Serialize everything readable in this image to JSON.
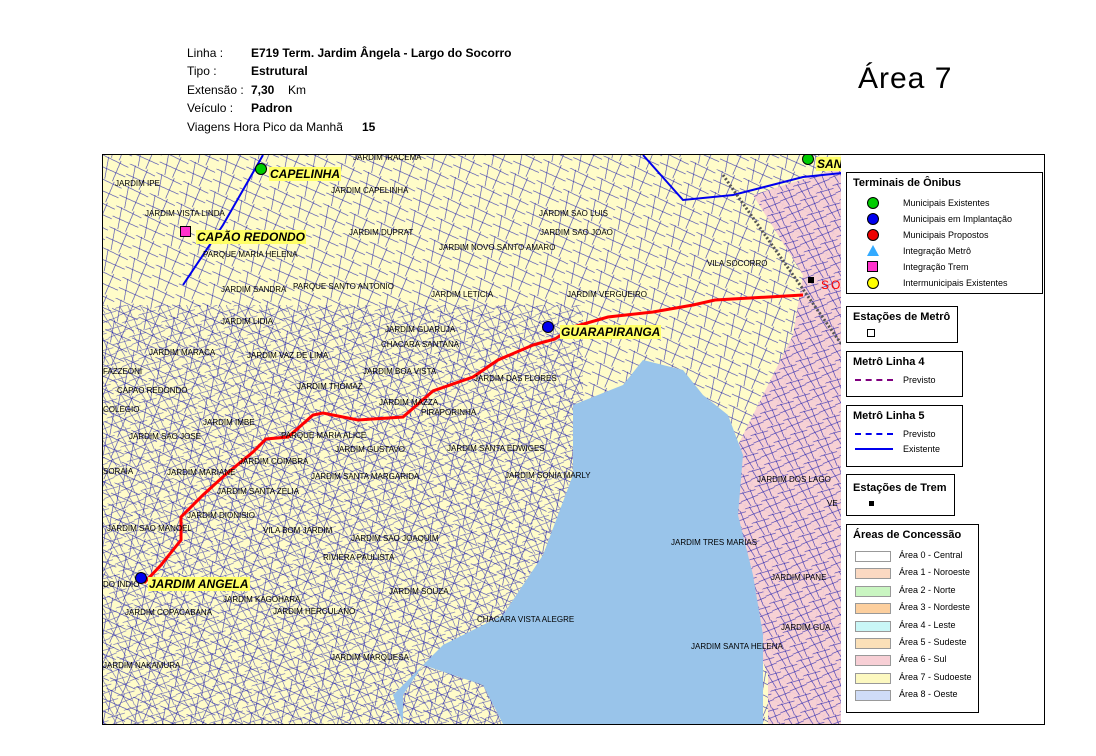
{
  "header": {
    "linha_label": "Linha :",
    "linha_value": "E719     Term. Jardim Ângela  - Largo do Socorro",
    "tipo_label": "Tipo :",
    "tipo_value": "Estrutural",
    "extensao_label": "Extensão :",
    "extensao_value": "7,30",
    "extensao_unit": "Km",
    "veiculo_label": "Veículo :",
    "veiculo_value": "Padron",
    "viagens_label": "Viagens Hora Pico da Manhã",
    "viagens_value": "15"
  },
  "area_title": "Área  7",
  "colors": {
    "route": "#ff0000",
    "water": "#99c4ea",
    "area6": "#f7cfd5",
    "area7": "#fffcc9",
    "streets": "#1111aa",
    "metro_line5": "#0000ee"
  },
  "terminals": [
    {
      "name": "CAPELINHA",
      "type": "municipal-existente",
      "color": "#00cc00"
    },
    {
      "name": "CAPÃO REDONDO",
      "type": "integracao-trem",
      "color": "#ff33cc"
    },
    {
      "name": "GUARAPIRANGA",
      "type": "municipal-implantacao",
      "color": "#0000ee"
    },
    {
      "name": "JARDIM ANGELA",
      "type": "municipal-implantacao",
      "color": "#0000ee"
    },
    {
      "name": "SAN",
      "type": "municipal-existente",
      "color": "#00cc00"
    },
    {
      "name": "SO",
      "type": "estacao-trem",
      "color": "#ff0000"
    }
  ],
  "neighborhoods": [
    "JARDIM IRACEMA",
    "JARDIM IPE",
    "JARDIM CAPELINHA",
    "JARDIM VISTA LINDA",
    "JARDIM SAO LUIS",
    "JARDIM DUPRAT",
    "JARDIM SAO JOAO",
    "JARDIM NOVO SANTO AMARO",
    "PARQUE MARIA HELENA",
    "VILA SOCORRO",
    "PARQUE SANTO ANTONIO",
    "JARDIM SANDRA",
    "JARDIM LETICIA",
    "JARDIM VERGUEIRO",
    "JARDIM LIDIA",
    "JARDIM GUARUJA",
    "CHACARA SANTANA",
    "JARDIM MARACA",
    "JARDIM VAZ DE LIMA",
    "FAZZEONI",
    "JARDIM BOA VISTA",
    "CAPAO REDONDO",
    "JARDIM THOMAZ",
    "JARDIM DAS FLORES",
    "JARDIM MAZZA",
    "COLEGIO",
    "PIRAPORINHA",
    "JARDIM IMBE",
    "PARQUE MARIA ALICE",
    "JARDIM SAO JOSE",
    "JARDIM GUSTAVO",
    "JARDIM SANTA EDWIGES",
    "JARDIM COIMBRA",
    "SORAIA",
    "JARDIM MARIANE",
    "JARDIM SANTA MARGARIDA",
    "JARDIM SONIA MARLY",
    "JARDIM DOS LAGO",
    "JARDIM SANTA ZELIA",
    "JARDIM DIONISIO",
    "JARDIM SAO MANOEL",
    "VILA BOM JARDIM",
    "JARDIM SAO JOAQUIM",
    "JARDIM TRES MARIAS",
    "RIVIERA PAULISTA",
    "JARDIM IPANE",
    "DO INDIO",
    "JARDIM KAGOHARA",
    "JARDIM SOUZA",
    "JARDIM COPACABANA",
    "JARDIM HERCULANO",
    "CHACARA VISTA ALEGRE",
    "JARDIM GUA",
    "JARDIM SANTA HELENA",
    "JARDIM MARQUESA",
    "JARDIM NAKAMURA",
    "VE"
  ],
  "legend": {
    "terminais_title": "Terminais de Ônibus",
    "terminais_items": [
      {
        "label": "Municipais Existentes",
        "color": "#00cc00",
        "shape": "circle"
      },
      {
        "label": "Municipais em Implantação",
        "color": "#0000ee",
        "shape": "circle"
      },
      {
        "label": "Municipais Propostos",
        "color": "#ee0000",
        "shape": "circle"
      },
      {
        "label": "Integração Metrô",
        "color": "#33aaff",
        "shape": "triangle"
      },
      {
        "label": "Integração Trem",
        "color": "#ff33cc",
        "shape": "square"
      },
      {
        "label": "Intermunicipais Existentes",
        "color": "#ffff00",
        "shape": "circle"
      }
    ],
    "estacoes_metro_title": "Estações de Metrô",
    "metro4_title": "Metrô Linha 4",
    "metro4_items": [
      {
        "label": "Previsto",
        "color": "#800080",
        "style": "dashed"
      }
    ],
    "metro5_title": "Metrô Linha 5",
    "metro5_items": [
      {
        "label": "Previsto",
        "color": "#0000ee",
        "style": "dashed"
      },
      {
        "label": "Existente",
        "color": "#0000ee",
        "style": "solid"
      }
    ],
    "estacoes_trem_title": "Estações de Trem",
    "areas_title": "Áreas de Concessão",
    "areas_items": [
      {
        "label": "Área 0 - Central",
        "color": "#ffffff"
      },
      {
        "label": "Área 1 - Noroeste",
        "color": "#fbd9c2"
      },
      {
        "label": "Área 2 - Norte",
        "color": "#c9f5c1"
      },
      {
        "label": "Área 3 - Nordeste",
        "color": "#fccf9e"
      },
      {
        "label": "Área 4 - Leste",
        "color": "#c9f6f6"
      },
      {
        "label": "Área 5 - Sudeste",
        "color": "#fbe0b8"
      },
      {
        "label": "Área 6 - Sul",
        "color": "#f7cfd5"
      },
      {
        "label": "Área 7 - Sudoeste",
        "color": "#fcf8c0"
      },
      {
        "label": "Área 8 - Oeste",
        "color": "#cfdcf7"
      }
    ]
  }
}
